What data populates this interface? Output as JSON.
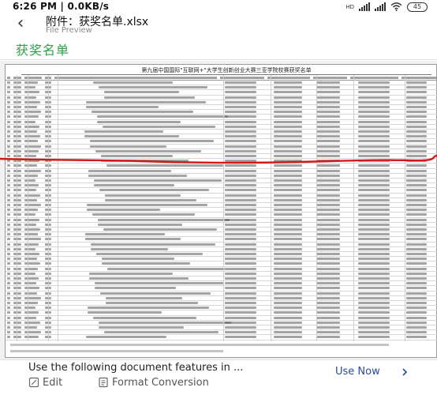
{
  "status_bar": {
    "time": "6:26 PM | 0.0KB/s",
    "network": "HD",
    "battery": "45"
  },
  "header": {
    "back_icon": "back-arrow-icon",
    "title": "附件：获奖名单.xlsx",
    "subtitle": "File Preview"
  },
  "sheet": {
    "tab_label": "获奖名单",
    "accent_color": "#2aa24a",
    "doc_title": "第九届中国国际\"互联网+\"大学生创新创业大赛三亚学院校赛获奖名单"
  },
  "annotation": {
    "color": "#d11a1a"
  },
  "bottom_bar": {
    "prompt": "Use the following document features in ...",
    "use_now_label": "Use Now",
    "edit_label": "Edit",
    "format_label": "Format Conversion",
    "link_color": "#2a4a9a"
  }
}
